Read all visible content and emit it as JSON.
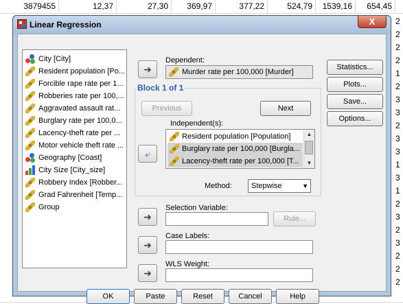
{
  "spreadsheet": {
    "top_row": [
      "3879455",
      "12,37",
      "27,30",
      "369,97",
      "377,22",
      "524,79",
      "1539,16",
      "654,45"
    ],
    "right_edge": [
      "2",
      "2",
      "2",
      "2",
      "1",
      "2",
      "3",
      "3",
      "2",
      "3",
      "3",
      "1",
      "3",
      "1",
      "2",
      "3",
      "2",
      "3",
      "2",
      "2",
      "2"
    ],
    "bottom_row": [
      "",
      "",
      "",
      "",
      "",
      "",
      "",
      "2"
    ]
  },
  "dialog": {
    "title": "Linear Regression",
    "close_glyph": "X"
  },
  "variables": [
    {
      "label": "City [City]",
      "icon": "nominal-icon"
    },
    {
      "label": "Resident population [Po...",
      "icon": "scale-icon"
    },
    {
      "label": "Forcible rape rate per 1...",
      "icon": "scale-icon"
    },
    {
      "label": "Robberies rate per 100,...",
      "icon": "scale-icon"
    },
    {
      "label": "Aggravated assault rat...",
      "icon": "scale-icon"
    },
    {
      "label": "Burglary rate per 100,0...",
      "icon": "scale-icon"
    },
    {
      "label": "Lacency-theft rate per ...",
      "icon": "scale-icon"
    },
    {
      "label": "Motor vehicle theft rate ...",
      "icon": "scale-icon"
    },
    {
      "label": "Geography [Coast]",
      "icon": "nominal-icon"
    },
    {
      "label": "City Size [City_size]",
      "icon": "ordinal-icon"
    },
    {
      "label": "Robbery Index [Robber...",
      "icon": "scale-icon"
    },
    {
      "label": "Grad Fahrenheit [Temp...",
      "icon": "scale-icon"
    },
    {
      "label": "Group",
      "icon": "scale-icon"
    }
  ],
  "dependent": {
    "label": "Dependent:",
    "value": "Murder rate per 100,000 [Murder]"
  },
  "block": {
    "title": "Block 1 of 1",
    "previous": "Previous",
    "next": "Next"
  },
  "independents": {
    "label": "Independent(s):",
    "items": [
      {
        "label": "Resident population [Population]",
        "selected": false
      },
      {
        "label": "Burglary rate per 100,000 [Burgla...",
        "selected": true
      },
      {
        "label": "Lacency-theft rate per 100,000 [T...",
        "selected": true
      }
    ]
  },
  "method": {
    "label": "Method:",
    "value": "Stepwise"
  },
  "selection_variable": {
    "label": "Selection Variable:",
    "rule": "Rule..."
  },
  "case_labels": {
    "label": "Case Labels:"
  },
  "wls_weight": {
    "label": "WLS Weight:"
  },
  "side_buttons": [
    "Statistics...",
    "Plots...",
    "Save...",
    "Options..."
  ],
  "footer_buttons": [
    "OK",
    "Paste",
    "Reset",
    "Cancel",
    "Help"
  ],
  "colors": {
    "dialog_frame": "#b4c7dd",
    "block_title": "#2f5fa6",
    "close_button": "#c0452b"
  }
}
